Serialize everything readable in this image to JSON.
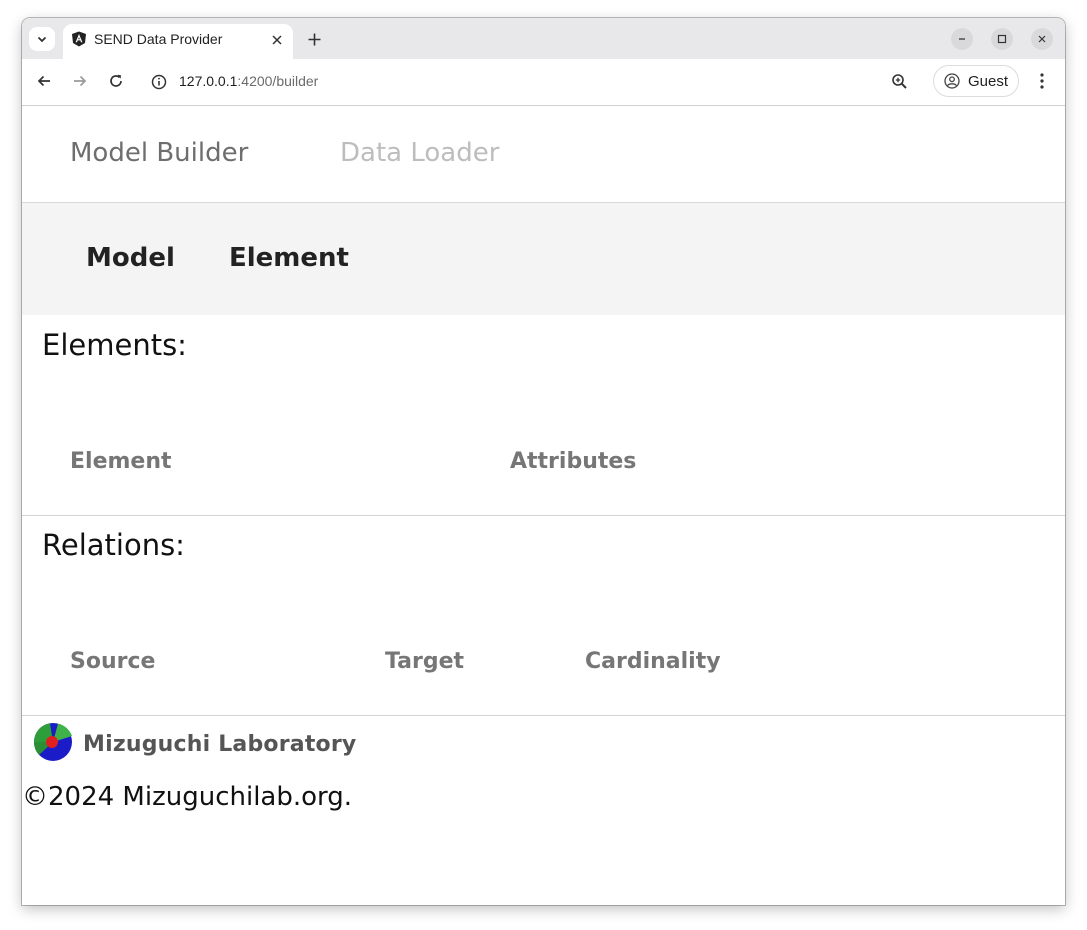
{
  "browser": {
    "tab_title": "SEND Data Provider",
    "url_host": "127.0.0.1",
    "url_rest": ":4200/builder",
    "profile_label": "Guest"
  },
  "nav": {
    "model_builder": "Model Builder",
    "data_loader": "Data Loader"
  },
  "subnav": {
    "model": "Model",
    "element": "Element"
  },
  "elements_section": {
    "title": "Elements:",
    "columns": [
      "Element",
      "Attributes"
    ]
  },
  "relations_section": {
    "title": "Relations:",
    "columns": [
      "Source",
      "Target",
      "Cardinality"
    ]
  },
  "footer": {
    "logo_text": "Mizuguchi Laboratory",
    "copyright": "©2024 Mizuguchilab.org."
  },
  "colors": {
    "nav_active": "#6e6e6e",
    "nav_inactive": "#bdbdbd",
    "subnav_bg": "#f4f4f4",
    "logo_green": "#2e9e3a",
    "logo_blue": "#1b1bc7",
    "logo_red": "#e02020"
  },
  "icons": [
    "tab-list-icon",
    "angular-favicon-icon",
    "close-icon",
    "plus-icon",
    "minimize-icon",
    "maximize-icon",
    "window-close-icon",
    "back-icon",
    "forward-icon",
    "reload-icon",
    "info-icon",
    "zoom-icon",
    "account-icon",
    "more-vert-icon"
  ]
}
